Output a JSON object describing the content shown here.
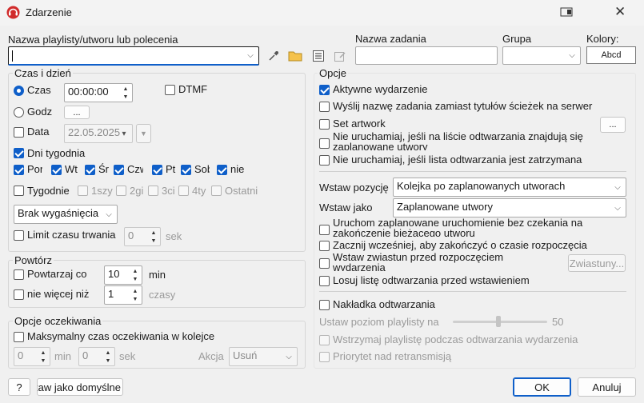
{
  "window": {
    "title": "Zdarzenie"
  },
  "top": {
    "playlist_label": "Nazwa playlisty/utworu lub polecenia",
    "playlist_value": "",
    "task_label": "Nazwa zadania",
    "task_value": "",
    "group_label": "Grupa",
    "group_value": "",
    "colors_label": "Kolory:",
    "colors_button": "Abcd"
  },
  "time_section": {
    "title": "Czas i dzień",
    "czas_label": "Czas",
    "czas_value": "00:00:00",
    "dtmf_label": "DTMF",
    "godz_label": "Godz",
    "godz_button": "...",
    "data_label": "Data",
    "data_value": "22.05.2025",
    "days_label": "Dni tygodnia",
    "days": [
      "Pon",
      "Wt",
      "Śr",
      "Czw",
      "Pt",
      "Sob",
      "nie"
    ],
    "weekly_label": "Tygodnie",
    "weeks": [
      "1szy",
      "2gi",
      "3ci",
      "4ty",
      "Ostatni"
    ],
    "expire_value": "Brak wygaśnięcia",
    "limit_label": "Limit czasu trwania",
    "limit_value": "0",
    "limit_unit": "sek"
  },
  "repeat_section": {
    "title": "Powtórz",
    "repeat_label": "Powtarzaj co",
    "repeat_value": "10",
    "repeat_unit": "min",
    "max_label": "nie więcej niż",
    "max_value": "1",
    "max_unit": "czasy"
  },
  "wait_section": {
    "title": "Opcje oczekiwania",
    "max_wait_label": "Maksymalny czas oczekiwania w kolejce",
    "min_value": "0",
    "min_unit": "min",
    "sec_value": "0",
    "sec_unit": "sek",
    "action_label": "Akcja",
    "action_value": "Usuń"
  },
  "options": {
    "title": "Opcje",
    "active_label": "Aktywne wydarzenie",
    "send_name_label": "Wyślij nazwę zadania zamiast tytułów ścieżek na serwer",
    "artwork_label": "Set artwork",
    "artwork_button": "...",
    "no_run_list_label": "Nie uruchamiaj, jeśli na liście odtwarzania znajdują się zaplanowane utwory",
    "no_run_stopped_label": "Nie uruchamiaj, jeśli lista odtwarzania jest zatrzymana",
    "insert_pos_label": "Wstaw pozycję",
    "insert_pos_value": "Kolejka po zaplanowanych utworach",
    "insert_as_label": "Wstaw jako",
    "insert_as_value": "Zaplanowane utwory",
    "run_now_label": "Uruchom zaplanowane uruchomienie bez czekania na zakończenie bieżącego utworu",
    "start_early_label": "Zacznij wcześniej, aby zakończyć o czasie rozpoczęcia",
    "trailer_label": "Wstaw zwiastun przed rozpoczęciem wydarzenia",
    "trailer_button": "Zwiastuny...",
    "shuffle_label": "Losuj listę odtwarzania przed wstawieniem",
    "overlay_label": "Nakładka odtwarzania",
    "level_label": "Ustaw poziom playlisty na",
    "level_value": "50",
    "pause_label": "Wstrzymaj playlistę podczas odtwarzania wydarzenia",
    "priority_label": "Priorytet nad retransmisją"
  },
  "footer": {
    "help_button": "?",
    "default_button": "Ustaw jako domyślne",
    "ok_button": "OK",
    "cancel_button": "Anuluj"
  },
  "colors": {
    "accent": "#0f5fc9"
  }
}
